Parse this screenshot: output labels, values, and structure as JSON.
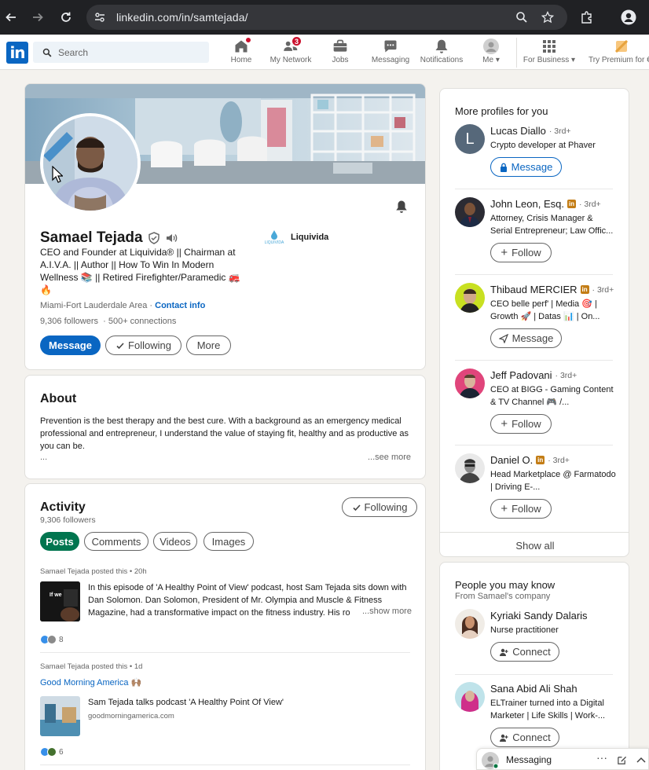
{
  "browser": {
    "url": "linkedin.com/in/samtejada/"
  },
  "nav": {
    "search_placeholder": "Search",
    "items": [
      {
        "label": "Home",
        "icon": "home-icon"
      },
      {
        "label": "My Network",
        "icon": "network-icon",
        "badge": "3"
      },
      {
        "label": "Jobs",
        "icon": "briefcase-icon"
      },
      {
        "label": "Messaging",
        "icon": "chat-icon"
      },
      {
        "label": "Notifications",
        "icon": "bell-icon"
      },
      {
        "label": "Me",
        "icon": "avatar-icon"
      },
      {
        "label": "For Business",
        "icon": "grid-icon"
      },
      {
        "label": "Try Premium for €",
        "icon": "premium-icon"
      }
    ]
  },
  "profile": {
    "name": "Samael Tejada",
    "headline": "CEO and Founder at Liquivida® || Chairman at A.I.V.A. || Author || How To Win In Modern Wellness 📚 || Retired Firefighter/Paramedic 🚒 🔥",
    "company": "Liquivida",
    "company_logo_text": "LIQUIVIDA",
    "location": "Miami-Fort Lauderdale Area",
    "location_sep": " · ",
    "contact_info": "Contact info",
    "followers": "9,306 followers",
    "connections": "500+ connections",
    "message_btn": "Message",
    "following_btn": "Following",
    "more_btn": "More"
  },
  "about": {
    "title": "About",
    "text": "Prevention is the best therapy and the best cure. With a background as an emergency medical professional and entrepreneur, I understand the value of staying fit, healthy and as productive as you can be.",
    "ellipsis": "...",
    "see_more": "...see more"
  },
  "activity": {
    "title": "Activity",
    "followers": "9,306 followers",
    "following_btn": "Following",
    "tabs": [
      "Posts",
      "Comments",
      "Videos",
      "Images"
    ],
    "posts": [
      {
        "meta": "Samael Tejada posted this • 20h",
        "thumb_text": "If we",
        "text": "In this episode of 'A Healthy Point of View' podcast, host Sam Tejada sits down with Dan Solomon. Dan Solomon, President of Mr. Olympia and Muscle & Fitness Magazine, had a transformative impact on the fitness industry. His ro",
        "show_more": "...show more",
        "reactions": "8"
      },
      {
        "meta": "Samael Tejada posted this • 1d",
        "link": "Good Morning America 🙌🏽",
        "title": "Sam Tejada talks podcast 'A Healthy Point Of View'",
        "source": "goodmorningamerica.com",
        "reactions": "6"
      }
    ]
  },
  "more_profiles": {
    "title": "More profiles for you",
    "people": [
      {
        "name": "Lucas Diallo",
        "degree": "· 3rd+",
        "headline": "Crypto developer at Phaver",
        "action": "Message",
        "initial": "L",
        "premium": false
      },
      {
        "name": "John Leon, Esq.",
        "degree": "· 3rd+",
        "headline": "Attorney, Crisis Manager & Serial Entrepreneur; Law Offic...",
        "action": "Follow",
        "premium": true
      },
      {
        "name": "Thibaud MERCIER",
        "degree": "· 3rd+",
        "headline": "CEO belle perf' | Media 🎯 | Growth 🚀 | Datas 📊 | On...",
        "action": "Message",
        "premium": true
      },
      {
        "name": "Jeff Padovani",
        "degree": "· 3rd+",
        "headline": "CEO at BIGG - Gaming Content & TV Channel 🎮 /...",
        "action": "Follow",
        "premium": false
      },
      {
        "name": "Daniel O.",
        "degree": "· 3rd+",
        "headline": "Head Marketplace @ Farmatodo | Driving E-...",
        "action": "Follow",
        "premium": true
      }
    ],
    "show_all": "Show all"
  },
  "people_know": {
    "title": "People you may know",
    "subtitle": "From Samael's company",
    "people": [
      {
        "name": "Kyriaki Sandy Dalaris",
        "headline": "Nurse practitioner",
        "action": "Connect"
      },
      {
        "name": "Sana Abid Ali Shah",
        "headline": "ELTrainer turned into a Digital Marketer | Life Skills | Work-...",
        "action": "Connect"
      }
    ]
  },
  "messaging": {
    "label": "Messaging"
  },
  "colors": {
    "brand": "#0a66c2",
    "active_tab": "#01754f",
    "premium": "#c37d16"
  }
}
